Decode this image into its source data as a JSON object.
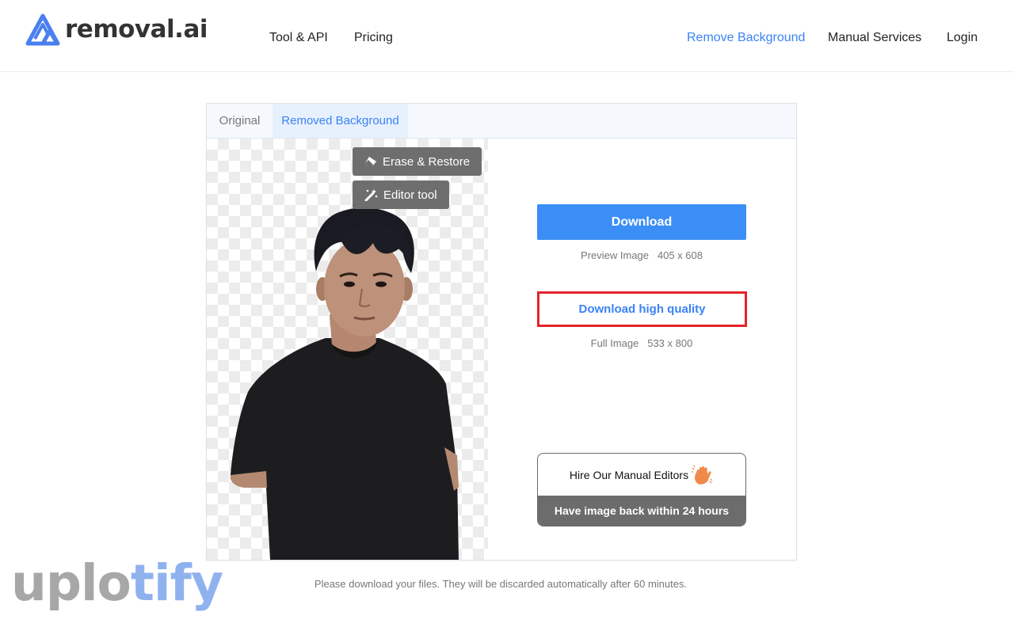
{
  "brand": {
    "name": "removal.ai",
    "color": "#3b82f6"
  },
  "nav": {
    "tool_api": "Tool & API",
    "pricing": "Pricing",
    "remove_background": "Remove Background",
    "manual_services": "Manual Services",
    "login": "Login"
  },
  "tabs": {
    "original": "Original",
    "removed": "Removed Background",
    "active": "Removed Background"
  },
  "tools": {
    "erase_restore": "Erase & Restore",
    "editor_tool": "Editor tool"
  },
  "actions": {
    "download": "Download",
    "preview_label": "Preview Image",
    "preview_size": "405 x 608",
    "download_hq": "Download high quality",
    "full_label": "Full Image",
    "full_size": "533 x 800"
  },
  "hire": {
    "title": "Hire Our Manual Editors",
    "subtitle": "Have image back within 24 hours"
  },
  "footer": {
    "note": "Please download your files. They will be discarded automatically after 60 minutes."
  },
  "watermark": {
    "part1": "uplo",
    "part2": "tify"
  },
  "colors": {
    "primary": "#3b8ef5",
    "highlight_border": "#e3232c",
    "tool_button": "#6e6e6e"
  }
}
